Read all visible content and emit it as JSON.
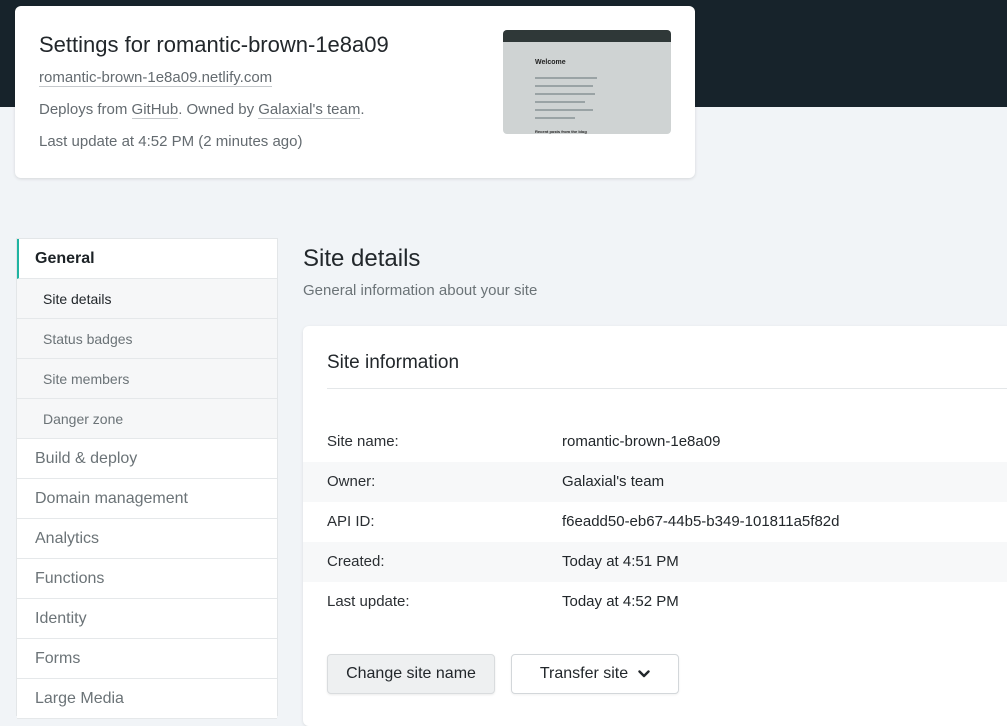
{
  "header": {
    "title": "Settings for romantic-brown-1e8a09",
    "url": "romantic-brown-1e8a09.netlify.com",
    "deploys_prefix": "Deploys from ",
    "deploys_source": "GitHub",
    "owned_prefix": ". Owned by ",
    "owner": "Galaxial's team",
    "owned_suffix": ".",
    "last_update": "Last update at 4:52 PM (2 minutes ago)"
  },
  "thumbnail": {
    "welcome": "Welcome",
    "recent": "Recent posts from the blog"
  },
  "sidebar": {
    "sections": [
      {
        "label": "General",
        "active": true
      },
      {
        "label": "Build & deploy"
      },
      {
        "label": "Domain management"
      },
      {
        "label": "Analytics"
      },
      {
        "label": "Functions"
      },
      {
        "label": "Identity"
      },
      {
        "label": "Forms"
      },
      {
        "label": "Large Media"
      }
    ],
    "general_sub": [
      "Site details",
      "Status badges",
      "Site members",
      "Danger zone"
    ]
  },
  "main": {
    "title": "Site details",
    "subtitle": "General information about your site"
  },
  "panel": {
    "title": "Site information",
    "rows": [
      {
        "key": "Site name:",
        "value": "romantic-brown-1e8a09"
      },
      {
        "key": "Owner:",
        "value": "Galaxial's team"
      },
      {
        "key": "API ID:",
        "value": "f6eadd50-eb67-44b5-b349-101811a5f82d"
      },
      {
        "key": "Created:",
        "value": "Today at 4:51 PM"
      },
      {
        "key": "Last update:",
        "value": "Today at 4:52 PM"
      }
    ],
    "change_name_label": "Change site name",
    "transfer_label": "Transfer site"
  },
  "colors": {
    "accent": "#20b4a2",
    "header_band": "#17232b"
  }
}
